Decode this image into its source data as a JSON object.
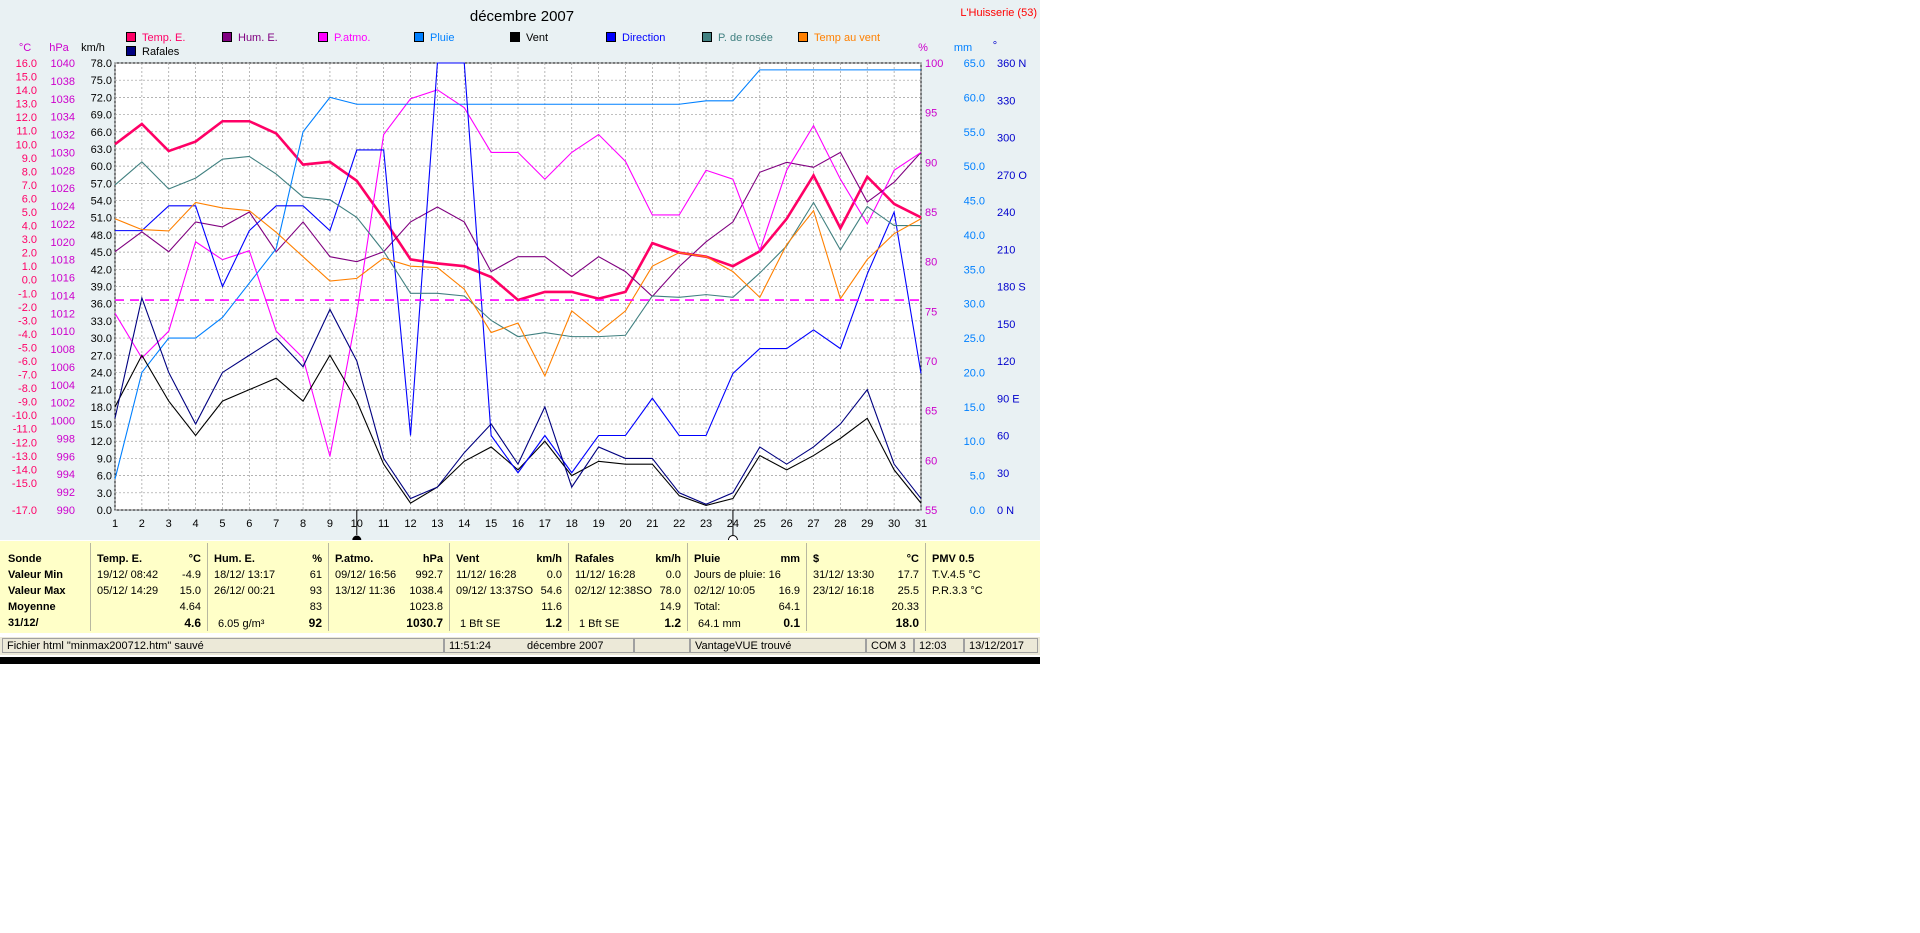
{
  "title": "décembre 2007",
  "station": "L'Huisserie (53)",
  "axis_units": {
    "temp": "°C",
    "hpa": "hPa",
    "kmh": "km/h",
    "pct": "%",
    "mm": "mm",
    "deg": "°"
  },
  "legend": [
    {
      "label": "Temp. E.",
      "color": "#ff0066"
    },
    {
      "label": "Hum. E.",
      "color": "#800080"
    },
    {
      "label": "P.atmo.",
      "color": "#ff00ff"
    },
    {
      "label": "Pluie",
      "color": "#0080ff"
    },
    {
      "label": "Vent",
      "color": "#000000"
    },
    {
      "label": "Direction",
      "color": "#0000ff"
    },
    {
      "label": "P. de rosée",
      "color": "#408080"
    },
    {
      "label": "Temp au vent",
      "color": "#ff8000"
    },
    {
      "label": "Rafales",
      "color": "#000080"
    }
  ],
  "chart_data": {
    "type": "line",
    "title": "décembre 2007",
    "x": [
      1,
      2,
      3,
      4,
      5,
      6,
      7,
      8,
      9,
      10,
      11,
      12,
      13,
      14,
      15,
      16,
      17,
      18,
      19,
      20,
      21,
      22,
      23,
      24,
      25,
      26,
      27,
      28,
      29,
      30,
      31
    ],
    "xlim": [
      1,
      31
    ],
    "grid": true,
    "axes": {
      "temp": {
        "unit": "°C",
        "ylim": [
          -17,
          16
        ],
        "ticks": [
          "16.0",
          "15.0",
          "14.0",
          "13.0",
          "12.0",
          "11.0",
          "10.0",
          "9.0",
          "8.0",
          "7.0",
          "6.0",
          "5.0",
          "4.0",
          "3.0",
          "2.0",
          "1.0",
          "0.0",
          "-1.0",
          "-2.0",
          "-3.0",
          "-4.0",
          "-5.0",
          "-6.0",
          "-7.0",
          "-8.0",
          "-9.0",
          "-10.0",
          "-11.0",
          "-12.0",
          "-13.0",
          "-14.0",
          "-15.0",
          "-17.0"
        ]
      },
      "pressure": {
        "unit": "hPa",
        "ylim": [
          990,
          1040
        ],
        "ticks": [
          "1040",
          "1038",
          "1036",
          "1034",
          "1032",
          "1030",
          "1028",
          "1026",
          "1024",
          "1022",
          "1020",
          "1018",
          "1016",
          "1014",
          "1012",
          "1010",
          "1008",
          "1006",
          "1004",
          "1002",
          "1000",
          "998",
          "996",
          "994",
          "992",
          "990"
        ]
      },
      "wind": {
        "unit": "km/h",
        "ylim": [
          0,
          78
        ],
        "ticks": [
          "78.0",
          "75.0",
          "72.0",
          "69.0",
          "66.0",
          "63.0",
          "60.0",
          "57.0",
          "54.0",
          "51.0",
          "48.0",
          "45.0",
          "42.0",
          "39.0",
          "36.0",
          "33.0",
          "30.0",
          "27.0",
          "24.0",
          "21.0",
          "18.0",
          "15.0",
          "12.0",
          "9.0",
          "6.0",
          "3.0",
          "0.0"
        ]
      },
      "humidity": {
        "unit": "%",
        "ylim": [
          55,
          100
        ],
        "ticks": [
          "100",
          "95",
          "90",
          "85",
          "80",
          "75",
          "70",
          "65",
          "60",
          "55"
        ]
      },
      "rain": {
        "unit": "mm",
        "ylim": [
          0,
          65
        ],
        "ticks": [
          "65.0",
          "60.0",
          "55.0",
          "50.0",
          "45.0",
          "40.0",
          "35.0",
          "30.0",
          "25.0",
          "20.0",
          "15.0",
          "10.0",
          "5.0",
          "0.0"
        ]
      },
      "direction": {
        "unit": "°",
        "ylim": [
          0,
          360
        ],
        "ticks": [
          "360 N",
          "330",
          "300",
          "270 O",
          "240",
          "210",
          "180 S",
          "150",
          "120",
          "90  E",
          "60",
          "30",
          "0    N"
        ]
      }
    },
    "series": [
      {
        "name": "Temp. E.",
        "axis": "temp",
        "color": "#ff0066",
        "values": [
          10.0,
          11.5,
          9.5,
          10.2,
          11.7,
          11.7,
          10.8,
          8.5,
          8.7,
          7.3,
          4.5,
          1.5,
          1.2,
          1.0,
          0.2,
          -1.5,
          -0.9,
          -0.9,
          -1.4,
          -0.9,
          2.7,
          2.0,
          1.7,
          1.0,
          2.1,
          4.5,
          7.7,
          3.8,
          7.6,
          5.6,
          4.6
        ]
      },
      {
        "name": "Hum. E.",
        "axis": "humidity",
        "color": "#800080",
        "values": [
          81,
          83,
          81,
          84,
          83.5,
          85,
          81,
          84,
          80.5,
          80,
          81,
          84,
          85.5,
          84,
          79,
          80.5,
          80.5,
          78.5,
          80.5,
          79,
          76.5,
          79.5,
          82,
          84,
          89,
          90,
          89.5,
          91,
          86,
          88,
          91
        ]
      },
      {
        "name": "P.atmo.",
        "axis": "pressure",
        "color": "#ff00ff",
        "values": [
          1012,
          1007,
          1010,
          1020,
          1018,
          1019,
          1010,
          1007,
          996,
          1012,
          1032,
          1036,
          1037,
          1035,
          1030,
          1030,
          1027,
          1030,
          1032,
          1029,
          1023,
          1023,
          1028,
          1027,
          1019,
          1028,
          1033,
          1027,
          1022,
          1028,
          1030
        ]
      },
      {
        "name": "Pluie",
        "axis": "rain",
        "color": "#0080ff",
        "values": [
          4.5,
          20,
          25,
          25,
          28,
          33,
          38,
          55,
          60,
          59,
          59,
          59,
          59,
          59,
          59,
          59,
          59,
          59,
          59,
          59,
          59,
          59,
          59.5,
          59.5,
          64,
          64,
          64,
          64,
          64,
          64,
          64
        ]
      },
      {
        "name": "Vent",
        "axis": "wind",
        "color": "#000000",
        "values": [
          18,
          27,
          19,
          13,
          19,
          21,
          23,
          19,
          27,
          19,
          8,
          1.2,
          4,
          8.5,
          11,
          7,
          12,
          6,
          8.5,
          8,
          8,
          2.5,
          0.8,
          2,
          9.5,
          7,
          9.5,
          12.5,
          16,
          7,
          1.2
        ]
      },
      {
        "name": "Direction",
        "axis": "direction",
        "color": "#0000ff",
        "values": [
          225,
          225,
          245,
          245,
          180,
          225,
          245,
          245,
          225,
          290,
          290,
          60,
          360,
          360,
          60,
          30,
          60,
          30,
          60,
          60,
          90,
          60,
          60,
          110,
          130,
          130,
          145,
          130,
          190,
          240,
          110
        ]
      },
      {
        "name": "P. de rosée",
        "axis": "temp",
        "color": "#408080",
        "values": [
          7.0,
          8.7,
          6.7,
          7.5,
          8.9,
          9.1,
          7.8,
          6.1,
          5.9,
          4.6,
          2.1,
          -1.0,
          -1.0,
          -1.2,
          -3.0,
          -4.2,
          -3.9,
          -4.2,
          -4.2,
          -4.1,
          -1.2,
          -1.3,
          -1.1,
          -1.3,
          0.5,
          2.5,
          5.7,
          2.2,
          5.4,
          4.0,
          4.0
        ]
      },
      {
        "name": "Temp au vent",
        "axis": "temp",
        "color": "#ff8000",
        "values": [
          4.5,
          3.7,
          3.6,
          5.7,
          5.3,
          5.1,
          3.5,
          1.7,
          -0.1,
          0.1,
          1.6,
          1.0,
          0.9,
          -0.7,
          -3.9,
          -3.2,
          -7.1,
          -2.3,
          -3.9,
          -2.3,
          1.0,
          2.0,
          1.7,
          0.6,
          -1.3,
          2.6,
          5.1,
          -1.4,
          1.5,
          3.4,
          4.5
        ]
      },
      {
        "name": "Rafales",
        "axis": "wind",
        "color": "#000080",
        "values": [
          16,
          37,
          24,
          15,
          24,
          27,
          30,
          25,
          35,
          26,
          9,
          2,
          4,
          10,
          15,
          8,
          18,
          4,
          11,
          9,
          9,
          3,
          1,
          3,
          11,
          8,
          11,
          15,
          21,
          8,
          2
        ]
      },
      {
        "name": "",
        "axis": "temp",
        "color": "#ff00ff",
        "dashed": true,
        "values": [
          -1.5,
          -1.5,
          -1.5,
          -1.5,
          -1.5,
          -1.5,
          -1.5,
          -1.5,
          -1.5,
          -1.5,
          -1.5,
          -1.5,
          -1.5,
          -1.5,
          -1.5,
          -1.5,
          -1.5,
          -1.5,
          -1.5,
          -1.5,
          -1.5,
          -1.5,
          -1.5,
          -1.5,
          -1.5,
          -1.5,
          -1.5,
          -1.5,
          -1.5,
          -1.5,
          -1.5
        ]
      }
    ],
    "markers": [
      {
        "day": 10,
        "symbol": "full-moon-dot"
      },
      {
        "day": 24,
        "symbol": "new-moon-circle"
      }
    ]
  },
  "stats": {
    "labels": {
      "sonde": "Sonde",
      "min": "Valeur Min",
      "max": "Valeur Max",
      "moyenne": "Moyenne",
      "current": "31/12/"
    },
    "temp": {
      "head": "Temp. E.",
      "unit": "°C",
      "min_date": "19/12/  08:42",
      "min_val": "-4.9",
      "max_date": "05/12/  14:29",
      "max_val": "15.0",
      "avg": "4.64",
      "cur": "4.6"
    },
    "hum": {
      "head": "Hum. E.",
      "unit": "%",
      "min_date": "18/12/  13:17",
      "min_val": "61",
      "max_date": "26/12/  00:21",
      "max_val": "93",
      "avg": "83",
      "cur_extra": "6.05 g/m³",
      "cur": "92"
    },
    "patmo": {
      "head": "P.atmo.",
      "unit": "hPa",
      "min_date": "09/12/  16:56",
      "min_val": "992.7",
      "max_date": "13/12/  11:36",
      "max_val": "1038.4",
      "avg": "1023.8",
      "cur": "1030.7"
    },
    "vent": {
      "head": "Vent",
      "unit": "km/h",
      "min_date": "11/12/  16:28",
      "min_val": "0.0",
      "max_date": "09/12/  13:37SO",
      "max_val": "54.6",
      "avg": "11.6",
      "cur_extra": "1 Bft SE",
      "cur": "1.2"
    },
    "raf": {
      "head": "Rafales",
      "unit": "km/h",
      "min_date": "11/12/  16:28",
      "min_val": "0.0",
      "max_date": "02/12/  12:38SO",
      "max_val": "78.0",
      "avg": "14.9",
      "cur_extra": "1 Bft SE",
      "cur": "1.2"
    },
    "pluie": {
      "head": "Pluie",
      "unit": "mm",
      "row1": "Jours de pluie: 16",
      "max_date": "02/12/  10:05",
      "max_val": "16.9",
      "total_label": "Total:",
      "total_val": "64.1",
      "cur_extra": "64.1 mm",
      "cur": "0.1"
    },
    "s": {
      "head": "$",
      "unit": "°C",
      "min_date": "31/12/  13:30",
      "min_val": "17.7",
      "max_date": "23/12/  16:18",
      "max_val": "25.5",
      "avg": "20.33",
      "cur": "18.0"
    },
    "pmv": {
      "head": "PMV 0.5",
      "tv": "T.V.4.5 °C",
      "pr": "P.R.3.3 °C"
    }
  },
  "status_bar": {
    "file_msg": "Fichier html  \"minmax200712.htm\"  sauvé",
    "time": "11:51:24",
    "month": "décembre 2007",
    "vantage": "VantageVUE trouvé",
    "com": "COM 3",
    "clock": "12:03",
    "date": "13/12/2017"
  }
}
